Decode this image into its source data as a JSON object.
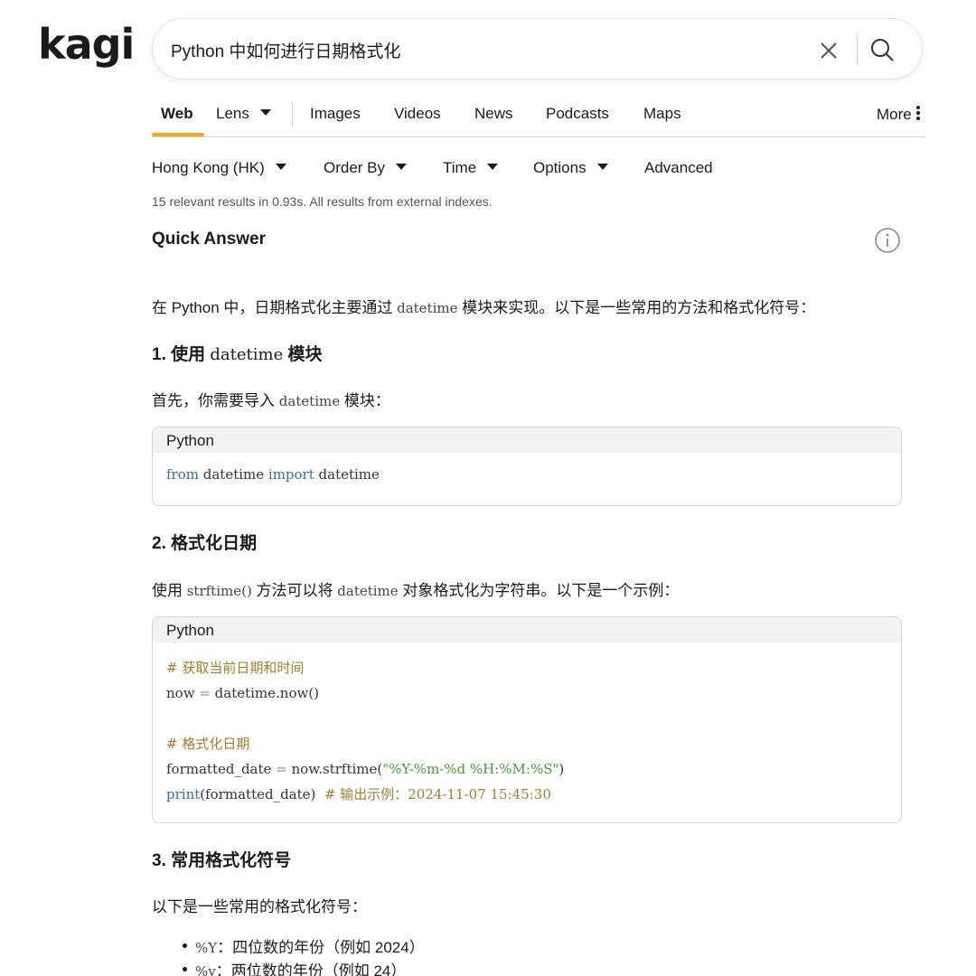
{
  "logo": "kagi",
  "search": {
    "value": "Python 中如何进行日期格式化",
    "placeholder": ""
  },
  "tabs": [
    {
      "label": "Web",
      "active": true
    },
    {
      "label": "Lens",
      "dropdown": true
    },
    {
      "label": "Images"
    },
    {
      "label": "Videos"
    },
    {
      "label": "News"
    },
    {
      "label": "Podcasts"
    },
    {
      "label": "Maps"
    },
    {
      "label": "More"
    }
  ],
  "filters": {
    "region": "Hong Kong (HK)",
    "order": "Order By",
    "time": "Time",
    "options": "Options",
    "advanced": "Advanced"
  },
  "result_stats": "15 relevant results in 0.93s. All results from external indexes.",
  "quick_answer": {
    "title": "Quick Answer",
    "intro_pre": "在 Python 中，日期格式化主要通过",
    "intro_code": "datetime",
    "intro_post": "模块来实现。以下是一些常用的方法和格式化符号：",
    "section1": {
      "title_pre": "1. 使用",
      "title_code": "datetime",
      "title_post": "模块",
      "text_pre": "首先，你需要导入",
      "text_code": "datetime",
      "text_post": "模块：",
      "code_lang": "Python",
      "code": {
        "kw_from": "from",
        "mod": " datetime ",
        "kw_import": "import",
        "name": " datetime"
      }
    },
    "section2": {
      "title": "2. 格式化日期",
      "text_a": "使用",
      "text_code1": "strftime()",
      "text_b": "方法可以将",
      "text_code2": "datetime",
      "text_c": "对象格式化为字符串。以下是一个示例：",
      "code_lang": "Python",
      "code": {
        "comment1": "# 获取当前日期和时间",
        "line2_a": "now ",
        "line2_eq": "=",
        "line2_b": " datetime.now()",
        "comment2": "# 格式化日期",
        "line5_a": "formatted_date ",
        "line5_eq": "=",
        "line5_b": " now.strftime(",
        "line5_str": "\"%Y-%m-%d %H:%M:%S\"",
        "line5_c": ")",
        "line6_kw": "print",
        "line6_a": "(formatted_date)  ",
        "line6_comment": "# 输出示例：2024-11-07 15:45:30"
      }
    },
    "section3": {
      "title": "3. 常用格式化符号",
      "text": "以下是一些常用的格式化符号：",
      "items": [
        {
          "code": "%Y",
          "text": "：四位数的年份（例如 2024）"
        },
        {
          "code": "%y",
          "text": "：两位数的年份（例如 24）"
        }
      ]
    }
  },
  "colors": {
    "accent": "#f5a623",
    "keyword": "#3a6ea5",
    "comment": "#a67c2e",
    "string": "#4a9a3a"
  }
}
